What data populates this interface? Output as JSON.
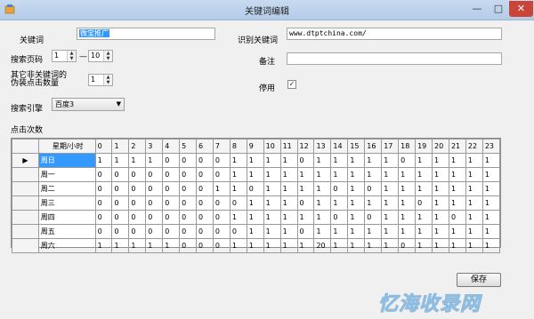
{
  "window": {
    "title": "关键词编辑",
    "min_glyph": "—",
    "max_glyph": "□",
    "close_glyph": "✕"
  },
  "form": {
    "keyword_label": "关键词",
    "keyword_value": "微宝推广",
    "search_page_label": "搜索页码",
    "page_from": "1",
    "page_sep": "—",
    "page_to": "10",
    "other_kw_label_1": "其它非关键词的",
    "other_kw_label_2": "伪装点击数量",
    "other_kw_value": "1",
    "engine_label": "搜索引擎",
    "engine_value": "百度3",
    "identify_label": "识别关键词",
    "identify_value": "www.dtptchina.com/",
    "remark_label": "备注",
    "remark_value": "",
    "enable_label": "停用",
    "enable_checked": "✓",
    "clicks_label": "点击次数"
  },
  "grid": {
    "header": "星期/小时",
    "hours": [
      "0",
      "1",
      "2",
      "3",
      "4",
      "5",
      "6",
      "7",
      "8",
      "9",
      "10",
      "11",
      "12",
      "13",
      "14",
      "15",
      "16",
      "17",
      "18",
      "19",
      "20",
      "21",
      "22",
      "23"
    ],
    "rows": [
      {
        "day": "周日",
        "values": [
          "1",
          "1",
          "1",
          "1",
          "0",
          "0",
          "0",
          "0",
          "1",
          "1",
          "1",
          "1",
          "0",
          "1",
          "1",
          "1",
          "1",
          "1",
          "0",
          "1",
          "1",
          "1",
          "1",
          "1"
        ]
      },
      {
        "day": "周一",
        "values": [
          "0",
          "0",
          "0",
          "0",
          "0",
          "0",
          "0",
          "0",
          "1",
          "1",
          "1",
          "1",
          "1",
          "1",
          "1",
          "1",
          "1",
          "1",
          "1",
          "1",
          "1",
          "1",
          "1",
          "1"
        ]
      },
      {
        "day": "周二",
        "values": [
          "0",
          "0",
          "0",
          "0",
          "0",
          "0",
          "0",
          "1",
          "1",
          "0",
          "1",
          "1",
          "1",
          "1",
          "0",
          "1",
          "0",
          "1",
          "1",
          "1",
          "1",
          "1",
          "1",
          "1"
        ]
      },
      {
        "day": "周三",
        "values": [
          "0",
          "0",
          "0",
          "0",
          "0",
          "0",
          "0",
          "0",
          "0",
          "1",
          "1",
          "1",
          "0",
          "1",
          "1",
          "1",
          "1",
          "1",
          "1",
          "0",
          "1",
          "1",
          "1",
          "1"
        ]
      },
      {
        "day": "周四",
        "values": [
          "0",
          "0",
          "0",
          "0",
          "0",
          "0",
          "0",
          "0",
          "1",
          "1",
          "1",
          "1",
          "1",
          "1",
          "0",
          "1",
          "0",
          "1",
          "1",
          "1",
          "1",
          "0",
          "1",
          "1"
        ]
      },
      {
        "day": "周五",
        "values": [
          "0",
          "0",
          "0",
          "0",
          "0",
          "0",
          "0",
          "0",
          "0",
          "1",
          "1",
          "1",
          "0",
          "1",
          "1",
          "1",
          "1",
          "1",
          "1",
          "1",
          "1",
          "1",
          "1",
          "1"
        ]
      },
      {
        "day": "周六",
        "values": [
          "1",
          "1",
          "1",
          "1",
          "1",
          "0",
          "0",
          "0",
          "1",
          "1",
          "1",
          "1",
          "1",
          "20",
          "1",
          "1",
          "1",
          "1",
          "0",
          "1",
          "1",
          "1",
          "1",
          "1"
        ]
      }
    ]
  },
  "buttons": {
    "save_label": "保存"
  },
  "watermark": "忆海收录网"
}
